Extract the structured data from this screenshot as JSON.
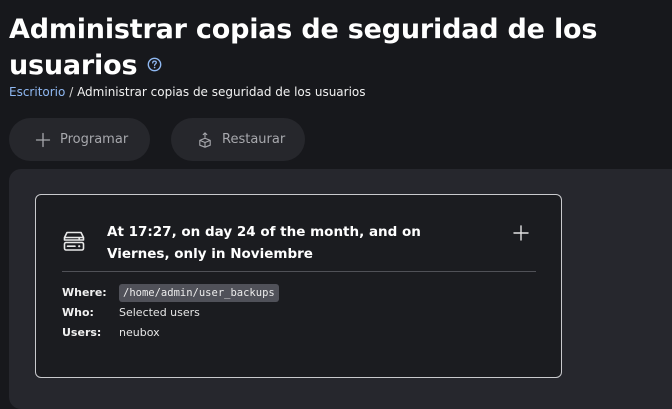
{
  "header": {
    "title": "Administrar copias de seguridad de los usuarios",
    "help_icon": "help-circle-icon"
  },
  "breadcrumb": {
    "root": "Escritorio",
    "separator": "/",
    "current": "Administrar copias de seguridad de los usuarios"
  },
  "toolbar": {
    "program": {
      "label": "Programar",
      "icon": "plus-icon"
    },
    "restore": {
      "label": "Restaurar",
      "icon": "box-restore-icon"
    }
  },
  "backup_task": {
    "icon": "storage-drives-icon",
    "schedule": "At 17:27, on day 24 of the month, and on Viernes, only in Noviembre",
    "add_icon": "plus-icon",
    "details": {
      "where_label": "Where:",
      "where_value": "/home/admin/user_backups",
      "who_label": "Who:",
      "who_value": "Selected users",
      "users_label": "Users:",
      "users_value": "neubox"
    }
  },
  "colors": {
    "background": "#17181c",
    "panel": "#26272d",
    "card": "#1b1c20",
    "link": "#8fb8f2",
    "help_icon": "#8fb8f2",
    "button_text": "#a7a8ad"
  }
}
